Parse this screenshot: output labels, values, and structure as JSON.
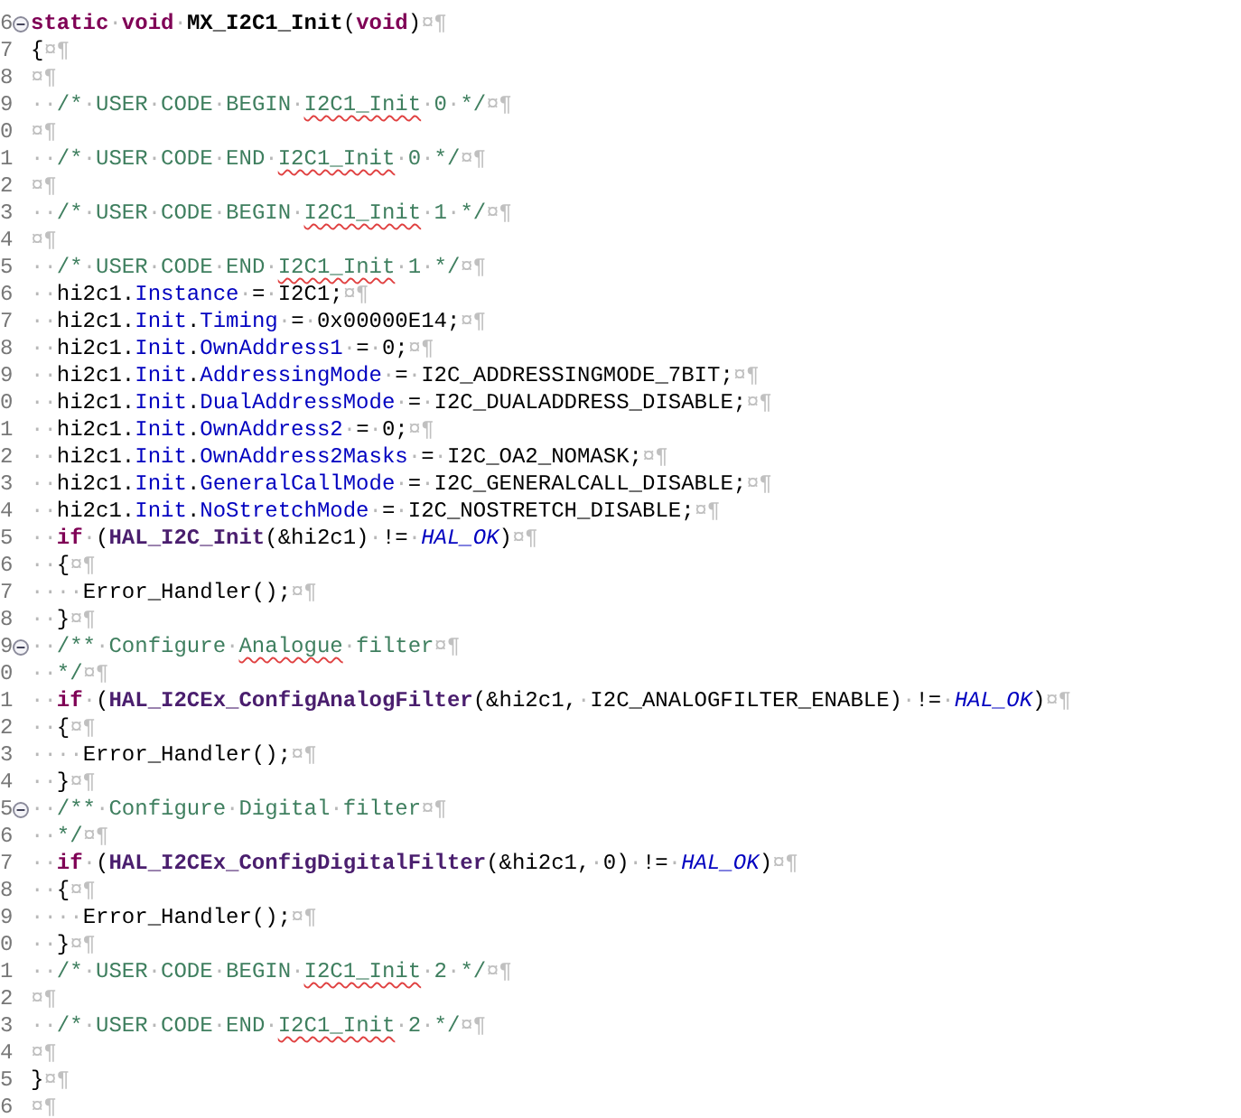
{
  "editor": {
    "lines": [
      {
        "number": "6",
        "fold": true,
        "tokens": [
          {
            "kind": "k",
            "text": "static"
          },
          {
            "kind": "w",
            "text": "·"
          },
          {
            "kind": "k",
            "text": "void"
          },
          {
            "kind": "w",
            "text": "·"
          },
          {
            "kind": "b",
            "text": "MX_I2C1_Init"
          },
          {
            "kind": "p",
            "text": "("
          },
          {
            "kind": "k",
            "text": "void"
          },
          {
            "kind": "p",
            "text": ")"
          },
          {
            "kind": "e",
            "text": "¤¶"
          }
        ]
      },
      {
        "number": "7",
        "fold": false,
        "tokens": [
          {
            "kind": "p",
            "text": "{"
          },
          {
            "kind": "e",
            "text": "¤¶"
          }
        ]
      },
      {
        "number": "8",
        "fold": false,
        "tokens": [
          {
            "kind": "e",
            "text": "¤¶"
          }
        ]
      },
      {
        "number": "9",
        "fold": false,
        "tokens": [
          {
            "kind": "w",
            "text": "··"
          },
          {
            "kind": "c",
            "text": "/*"
          },
          {
            "kind": "w",
            "text": "·"
          },
          {
            "kind": "c",
            "text": "USER"
          },
          {
            "kind": "w",
            "text": "·"
          },
          {
            "kind": "c",
            "text": "CODE"
          },
          {
            "kind": "w",
            "text": "·"
          },
          {
            "kind": "c",
            "text": "BEGIN"
          },
          {
            "kind": "w",
            "text": "·"
          },
          {
            "kind": "s",
            "text": "I2C1_Init"
          },
          {
            "kind": "w",
            "text": "·"
          },
          {
            "kind": "c",
            "text": "0"
          },
          {
            "kind": "w",
            "text": "·"
          },
          {
            "kind": "c",
            "text": "*/"
          },
          {
            "kind": "e",
            "text": "¤¶"
          }
        ]
      },
      {
        "number": "0",
        "fold": false,
        "tokens": [
          {
            "kind": "e",
            "text": "¤¶"
          }
        ]
      },
      {
        "number": "1",
        "fold": false,
        "tokens": [
          {
            "kind": "w",
            "text": "··"
          },
          {
            "kind": "c",
            "text": "/*"
          },
          {
            "kind": "w",
            "text": "·"
          },
          {
            "kind": "c",
            "text": "USER"
          },
          {
            "kind": "w",
            "text": "·"
          },
          {
            "kind": "c",
            "text": "CODE"
          },
          {
            "kind": "w",
            "text": "·"
          },
          {
            "kind": "c",
            "text": "END"
          },
          {
            "kind": "w",
            "text": "·"
          },
          {
            "kind": "s",
            "text": "I2C1_Init"
          },
          {
            "kind": "w",
            "text": "·"
          },
          {
            "kind": "c",
            "text": "0"
          },
          {
            "kind": "w",
            "text": "·"
          },
          {
            "kind": "c",
            "text": "*/"
          },
          {
            "kind": "e",
            "text": "¤¶"
          }
        ]
      },
      {
        "number": "2",
        "fold": false,
        "tokens": [
          {
            "kind": "e",
            "text": "¤¶"
          }
        ]
      },
      {
        "number": "3",
        "fold": false,
        "tokens": [
          {
            "kind": "w",
            "text": "··"
          },
          {
            "kind": "c",
            "text": "/*"
          },
          {
            "kind": "w",
            "text": "·"
          },
          {
            "kind": "c",
            "text": "USER"
          },
          {
            "kind": "w",
            "text": "·"
          },
          {
            "kind": "c",
            "text": "CODE"
          },
          {
            "kind": "w",
            "text": "·"
          },
          {
            "kind": "c",
            "text": "BEGIN"
          },
          {
            "kind": "w",
            "text": "·"
          },
          {
            "kind": "s",
            "text": "I2C1_Init"
          },
          {
            "kind": "w",
            "text": "·"
          },
          {
            "kind": "c",
            "text": "1"
          },
          {
            "kind": "w",
            "text": "·"
          },
          {
            "kind": "c",
            "text": "*/"
          },
          {
            "kind": "e",
            "text": "¤¶"
          }
        ]
      },
      {
        "number": "4",
        "fold": false,
        "tokens": [
          {
            "kind": "e",
            "text": "¤¶"
          }
        ]
      },
      {
        "number": "5",
        "fold": false,
        "tokens": [
          {
            "kind": "w",
            "text": "··"
          },
          {
            "kind": "c",
            "text": "/*"
          },
          {
            "kind": "w",
            "text": "·"
          },
          {
            "kind": "c",
            "text": "USER"
          },
          {
            "kind": "w",
            "text": "·"
          },
          {
            "kind": "c",
            "text": "CODE"
          },
          {
            "kind": "w",
            "text": "·"
          },
          {
            "kind": "c",
            "text": "END"
          },
          {
            "kind": "w",
            "text": "·"
          },
          {
            "kind": "s",
            "text": "I2C1_Init"
          },
          {
            "kind": "w",
            "text": "·"
          },
          {
            "kind": "c",
            "text": "1"
          },
          {
            "kind": "w",
            "text": "·"
          },
          {
            "kind": "c",
            "text": "*/"
          },
          {
            "kind": "e",
            "text": "¤¶"
          }
        ]
      },
      {
        "number": "6",
        "fold": false,
        "tokens": [
          {
            "kind": "w",
            "text": "··"
          },
          {
            "kind": "p",
            "text": "hi2c1."
          },
          {
            "kind": "f",
            "text": "Instance"
          },
          {
            "kind": "w",
            "text": "·"
          },
          {
            "kind": "p",
            "text": "="
          },
          {
            "kind": "w",
            "text": "·"
          },
          {
            "kind": "p",
            "text": "I2C1;"
          },
          {
            "kind": "e",
            "text": "¤¶"
          }
        ]
      },
      {
        "number": "7",
        "fold": false,
        "tokens": [
          {
            "kind": "w",
            "text": "··"
          },
          {
            "kind": "p",
            "text": "hi2c1."
          },
          {
            "kind": "f",
            "text": "Init"
          },
          {
            "kind": "p",
            "text": "."
          },
          {
            "kind": "f",
            "text": "Timing"
          },
          {
            "kind": "w",
            "text": "·"
          },
          {
            "kind": "p",
            "text": "="
          },
          {
            "kind": "w",
            "text": "·"
          },
          {
            "kind": "p",
            "text": "0x00000E14;"
          },
          {
            "kind": "e",
            "text": "¤¶"
          }
        ]
      },
      {
        "number": "8",
        "fold": false,
        "tokens": [
          {
            "kind": "w",
            "text": "··"
          },
          {
            "kind": "p",
            "text": "hi2c1."
          },
          {
            "kind": "f",
            "text": "Init"
          },
          {
            "kind": "p",
            "text": "."
          },
          {
            "kind": "f",
            "text": "OwnAddress1"
          },
          {
            "kind": "w",
            "text": "·"
          },
          {
            "kind": "p",
            "text": "="
          },
          {
            "kind": "w",
            "text": "·"
          },
          {
            "kind": "p",
            "text": "0;"
          },
          {
            "kind": "e",
            "text": "¤¶"
          }
        ]
      },
      {
        "number": "9",
        "fold": false,
        "tokens": [
          {
            "kind": "w",
            "text": "··"
          },
          {
            "kind": "p",
            "text": "hi2c1."
          },
          {
            "kind": "f",
            "text": "Init"
          },
          {
            "kind": "p",
            "text": "."
          },
          {
            "kind": "f",
            "text": "AddressingMode"
          },
          {
            "kind": "w",
            "text": "·"
          },
          {
            "kind": "p",
            "text": "="
          },
          {
            "kind": "w",
            "text": "·"
          },
          {
            "kind": "p",
            "text": "I2C_ADDRESSINGMODE_7BIT;"
          },
          {
            "kind": "e",
            "text": "¤¶"
          }
        ]
      },
      {
        "number": "0",
        "fold": false,
        "tokens": [
          {
            "kind": "w",
            "text": "··"
          },
          {
            "kind": "p",
            "text": "hi2c1."
          },
          {
            "kind": "f",
            "text": "Init"
          },
          {
            "kind": "p",
            "text": "."
          },
          {
            "kind": "f",
            "text": "DualAddressMode"
          },
          {
            "kind": "w",
            "text": "·"
          },
          {
            "kind": "p",
            "text": "="
          },
          {
            "kind": "w",
            "text": "·"
          },
          {
            "kind": "p",
            "text": "I2C_DUALADDRESS_DISABLE;"
          },
          {
            "kind": "e",
            "text": "¤¶"
          }
        ]
      },
      {
        "number": "1",
        "fold": false,
        "tokens": [
          {
            "kind": "w",
            "text": "··"
          },
          {
            "kind": "p",
            "text": "hi2c1."
          },
          {
            "kind": "f",
            "text": "Init"
          },
          {
            "kind": "p",
            "text": "."
          },
          {
            "kind": "f",
            "text": "OwnAddress2"
          },
          {
            "kind": "w",
            "text": "·"
          },
          {
            "kind": "p",
            "text": "="
          },
          {
            "kind": "w",
            "text": "·"
          },
          {
            "kind": "p",
            "text": "0;"
          },
          {
            "kind": "e",
            "text": "¤¶"
          }
        ]
      },
      {
        "number": "2",
        "fold": false,
        "tokens": [
          {
            "kind": "w",
            "text": "··"
          },
          {
            "kind": "p",
            "text": "hi2c1."
          },
          {
            "kind": "f",
            "text": "Init"
          },
          {
            "kind": "p",
            "text": "."
          },
          {
            "kind": "f",
            "text": "OwnAddress2Masks"
          },
          {
            "kind": "w",
            "text": "·"
          },
          {
            "kind": "p",
            "text": "="
          },
          {
            "kind": "w",
            "text": "·"
          },
          {
            "kind": "p",
            "text": "I2C_OA2_NOMASK;"
          },
          {
            "kind": "e",
            "text": "¤¶"
          }
        ]
      },
      {
        "number": "3",
        "fold": false,
        "tokens": [
          {
            "kind": "w",
            "text": "··"
          },
          {
            "kind": "p",
            "text": "hi2c1."
          },
          {
            "kind": "f",
            "text": "Init"
          },
          {
            "kind": "p",
            "text": "."
          },
          {
            "kind": "f",
            "text": "GeneralCallMode"
          },
          {
            "kind": "w",
            "text": "·"
          },
          {
            "kind": "p",
            "text": "="
          },
          {
            "kind": "w",
            "text": "·"
          },
          {
            "kind": "p",
            "text": "I2C_GENERALCALL_DISABLE;"
          },
          {
            "kind": "e",
            "text": "¤¶"
          }
        ]
      },
      {
        "number": "4",
        "fold": false,
        "tokens": [
          {
            "kind": "w",
            "text": "··"
          },
          {
            "kind": "p",
            "text": "hi2c1."
          },
          {
            "kind": "f",
            "text": "Init"
          },
          {
            "kind": "p",
            "text": "."
          },
          {
            "kind": "f",
            "text": "NoStretchMode"
          },
          {
            "kind": "w",
            "text": "·"
          },
          {
            "kind": "p",
            "text": "="
          },
          {
            "kind": "w",
            "text": "·"
          },
          {
            "kind": "p",
            "text": "I2C_NOSTRETCH_DISABLE;"
          },
          {
            "kind": "e",
            "text": "¤¶"
          }
        ]
      },
      {
        "number": "5",
        "fold": false,
        "tokens": [
          {
            "kind": "w",
            "text": "··"
          },
          {
            "kind": "k",
            "text": "if"
          },
          {
            "kind": "w",
            "text": "·"
          },
          {
            "kind": "p",
            "text": "("
          },
          {
            "kind": "m",
            "text": "HAL_I2C_Init"
          },
          {
            "kind": "p",
            "text": "(&hi2c1)"
          },
          {
            "kind": "w",
            "text": "·"
          },
          {
            "kind": "p",
            "text": "!="
          },
          {
            "kind": "w",
            "text": "·"
          },
          {
            "kind": "i",
            "text": "HAL_OK"
          },
          {
            "kind": "p",
            "text": ")"
          },
          {
            "kind": "e",
            "text": "¤¶"
          }
        ]
      },
      {
        "number": "6",
        "fold": false,
        "tokens": [
          {
            "kind": "w",
            "text": "··"
          },
          {
            "kind": "p",
            "text": "{"
          },
          {
            "kind": "e",
            "text": "¤¶"
          }
        ]
      },
      {
        "number": "7",
        "fold": false,
        "tokens": [
          {
            "kind": "w",
            "text": "····"
          },
          {
            "kind": "p",
            "text": "Error_Handler();"
          },
          {
            "kind": "e",
            "text": "¤¶"
          }
        ]
      },
      {
        "number": "8",
        "fold": false,
        "tokens": [
          {
            "kind": "w",
            "text": "··"
          },
          {
            "kind": "p",
            "text": "}"
          },
          {
            "kind": "e",
            "text": "¤¶"
          }
        ]
      },
      {
        "number": "9",
        "fold": true,
        "tokens": [
          {
            "kind": "w",
            "text": "··"
          },
          {
            "kind": "c",
            "text": "/**"
          },
          {
            "kind": "w",
            "text": "·"
          },
          {
            "kind": "c",
            "text": "Configure"
          },
          {
            "kind": "w",
            "text": "·"
          },
          {
            "kind": "s",
            "text": "Analogue"
          },
          {
            "kind": "w",
            "text": "·"
          },
          {
            "kind": "c",
            "text": "filter"
          },
          {
            "kind": "e",
            "text": "¤¶"
          }
        ]
      },
      {
        "number": "0",
        "fold": false,
        "tokens": [
          {
            "kind": "w",
            "text": "··"
          },
          {
            "kind": "c",
            "text": "*/"
          },
          {
            "kind": "e",
            "text": "¤¶"
          }
        ]
      },
      {
        "number": "1",
        "fold": false,
        "tokens": [
          {
            "kind": "w",
            "text": "··"
          },
          {
            "kind": "k",
            "text": "if"
          },
          {
            "kind": "w",
            "text": "·"
          },
          {
            "kind": "p",
            "text": "("
          },
          {
            "kind": "m",
            "text": "HAL_I2CEx_ConfigAnalogFilter"
          },
          {
            "kind": "p",
            "text": "(&hi2c1,"
          },
          {
            "kind": "w",
            "text": "·"
          },
          {
            "kind": "p",
            "text": "I2C_ANALOGFILTER_ENABLE)"
          },
          {
            "kind": "w",
            "text": "·"
          },
          {
            "kind": "p",
            "text": "!="
          },
          {
            "kind": "w",
            "text": "·"
          },
          {
            "kind": "i",
            "text": "HAL_OK"
          },
          {
            "kind": "p",
            "text": ")"
          },
          {
            "kind": "e",
            "text": "¤¶"
          }
        ]
      },
      {
        "number": "2",
        "fold": false,
        "tokens": [
          {
            "kind": "w",
            "text": "··"
          },
          {
            "kind": "p",
            "text": "{"
          },
          {
            "kind": "e",
            "text": "¤¶"
          }
        ]
      },
      {
        "number": "3",
        "fold": false,
        "tokens": [
          {
            "kind": "w",
            "text": "····"
          },
          {
            "kind": "p",
            "text": "Error_Handler();"
          },
          {
            "kind": "e",
            "text": "¤¶"
          }
        ]
      },
      {
        "number": "4",
        "fold": false,
        "tokens": [
          {
            "kind": "w",
            "text": "··"
          },
          {
            "kind": "p",
            "text": "}"
          },
          {
            "kind": "e",
            "text": "¤¶"
          }
        ]
      },
      {
        "number": "5",
        "fold": true,
        "tokens": [
          {
            "kind": "w",
            "text": "··"
          },
          {
            "kind": "c",
            "text": "/**"
          },
          {
            "kind": "w",
            "text": "·"
          },
          {
            "kind": "c",
            "text": "Configure"
          },
          {
            "kind": "w",
            "text": "·"
          },
          {
            "kind": "c",
            "text": "Digital"
          },
          {
            "kind": "w",
            "text": "·"
          },
          {
            "kind": "c",
            "text": "filter"
          },
          {
            "kind": "e",
            "text": "¤¶"
          }
        ]
      },
      {
        "number": "6",
        "fold": false,
        "tokens": [
          {
            "kind": "w",
            "text": "··"
          },
          {
            "kind": "c",
            "text": "*/"
          },
          {
            "kind": "e",
            "text": "¤¶"
          }
        ]
      },
      {
        "number": "7",
        "fold": false,
        "tokens": [
          {
            "kind": "w",
            "text": "··"
          },
          {
            "kind": "k",
            "text": "if"
          },
          {
            "kind": "w",
            "text": "·"
          },
          {
            "kind": "p",
            "text": "("
          },
          {
            "kind": "m",
            "text": "HAL_I2CEx_ConfigDigitalFilter"
          },
          {
            "kind": "p",
            "text": "(&hi2c1,"
          },
          {
            "kind": "w",
            "text": "·"
          },
          {
            "kind": "p",
            "text": "0)"
          },
          {
            "kind": "w",
            "text": "·"
          },
          {
            "kind": "p",
            "text": "!="
          },
          {
            "kind": "w",
            "text": "·"
          },
          {
            "kind": "i",
            "text": "HAL_OK"
          },
          {
            "kind": "p",
            "text": ")"
          },
          {
            "kind": "e",
            "text": "¤¶"
          }
        ]
      },
      {
        "number": "8",
        "fold": false,
        "tokens": [
          {
            "kind": "w",
            "text": "··"
          },
          {
            "kind": "p",
            "text": "{"
          },
          {
            "kind": "e",
            "text": "¤¶"
          }
        ]
      },
      {
        "number": "9",
        "fold": false,
        "tokens": [
          {
            "kind": "w",
            "text": "····"
          },
          {
            "kind": "p",
            "text": "Error_Handler();"
          },
          {
            "kind": "e",
            "text": "¤¶"
          }
        ]
      },
      {
        "number": "0",
        "fold": false,
        "tokens": [
          {
            "kind": "w",
            "text": "··"
          },
          {
            "kind": "p",
            "text": "}"
          },
          {
            "kind": "e",
            "text": "¤¶"
          }
        ]
      },
      {
        "number": "1",
        "fold": false,
        "tokens": [
          {
            "kind": "w",
            "text": "··"
          },
          {
            "kind": "c",
            "text": "/*"
          },
          {
            "kind": "w",
            "text": "·"
          },
          {
            "kind": "c",
            "text": "USER"
          },
          {
            "kind": "w",
            "text": "·"
          },
          {
            "kind": "c",
            "text": "CODE"
          },
          {
            "kind": "w",
            "text": "·"
          },
          {
            "kind": "c",
            "text": "BEGIN"
          },
          {
            "kind": "w",
            "text": "·"
          },
          {
            "kind": "s",
            "text": "I2C1_Init"
          },
          {
            "kind": "w",
            "text": "·"
          },
          {
            "kind": "c",
            "text": "2"
          },
          {
            "kind": "w",
            "text": "·"
          },
          {
            "kind": "c",
            "text": "*/"
          },
          {
            "kind": "e",
            "text": "¤¶"
          }
        ]
      },
      {
        "number": "2",
        "fold": false,
        "tokens": [
          {
            "kind": "e",
            "text": "¤¶"
          }
        ]
      },
      {
        "number": "3",
        "fold": false,
        "tokens": [
          {
            "kind": "w",
            "text": "··"
          },
          {
            "kind": "c",
            "text": "/*"
          },
          {
            "kind": "w",
            "text": "·"
          },
          {
            "kind": "c",
            "text": "USER"
          },
          {
            "kind": "w",
            "text": "·"
          },
          {
            "kind": "c",
            "text": "CODE"
          },
          {
            "kind": "w",
            "text": "·"
          },
          {
            "kind": "c",
            "text": "END"
          },
          {
            "kind": "w",
            "text": "·"
          },
          {
            "kind": "s",
            "text": "I2C1_Init"
          },
          {
            "kind": "w",
            "text": "·"
          },
          {
            "kind": "c",
            "text": "2"
          },
          {
            "kind": "w",
            "text": "·"
          },
          {
            "kind": "c",
            "text": "*/"
          },
          {
            "kind": "e",
            "text": "¤¶"
          }
        ]
      },
      {
        "number": "4",
        "fold": false,
        "tokens": [
          {
            "kind": "e",
            "text": "¤¶"
          }
        ]
      },
      {
        "number": "5",
        "fold": false,
        "tokens": [
          {
            "kind": "p",
            "text": "}"
          },
          {
            "kind": "e",
            "text": "¤¶"
          }
        ]
      },
      {
        "number": "6",
        "fold": false,
        "tokens": [
          {
            "kind": "e",
            "text": "¤¶"
          }
        ]
      }
    ]
  }
}
